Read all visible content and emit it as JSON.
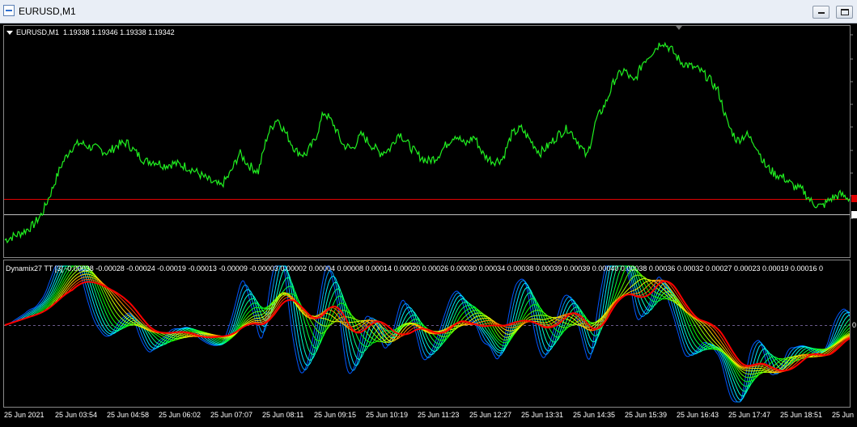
{
  "window": {
    "title": "EURUSD,M1"
  },
  "main_chart": {
    "symbol_label": "EURUSD,M1",
    "ohlc": "1.19338 1.19346 1.19338 1.19342",
    "line_color": "#20f020",
    "current_price_line_color": "#e00000",
    "ask_line_color": "#c0c0c0",
    "background": "#000000"
  },
  "indicator": {
    "name": "Dynamix27 TT [3]",
    "values": "-0.00038 -0.00028 -0.00024 -0.00019 -0.00013 -0.00009 -0.00003 0.00002 0.00004 0.00008 0.00014 0.00020 0.00026 0.00030 0.00034 0.00038 0.00039 0.00039 0.00040 0.00038 0.00036 0.00032 0.00027 0.00023 0.00019 0.00016 0",
    "zero_label": "0",
    "top_right_label": "0"
  },
  "time_axis": {
    "labels": [
      "25 Jun 2021",
      "25 Jun 03:54",
      "25 Jun 04:58",
      "25 Jun 06:02",
      "25 Jun 07:07",
      "25 Jun 08:11",
      "25 Jun 09:15",
      "25 Jun 10:19",
      "25 Jun 11:23",
      "25 Jun 12:27",
      "25 Jun 13:31",
      "25 Jun 14:35",
      "25 Jun 15:39",
      "25 Jun 16:43",
      "25 Jun 17:47",
      "25 Jun 18:51",
      "25 Jun"
    ]
  },
  "chart_data": {
    "type": "line",
    "series": [
      {
        "values": [
          0.04,
          0.06,
          0.08,
          0.11,
          0.17,
          0.28,
          0.4,
          0.48,
          0.51,
          0.49,
          0.48,
          0.46,
          0.5,
          0.51,
          0.46,
          0.42,
          0.42,
          0.4,
          0.41,
          0.4,
          0.38,
          0.35,
          0.32,
          0.3,
          0.36,
          0.46,
          0.4,
          0.37,
          0.55,
          0.63,
          0.55,
          0.47,
          0.45,
          0.52,
          0.66,
          0.6,
          0.5,
          0.48,
          0.55,
          0.5,
          0.46,
          0.48,
          0.56,
          0.5,
          0.45,
          0.42,
          0.44,
          0.5,
          0.55,
          0.5,
          0.54,
          0.45,
          0.42,
          0.43,
          0.55,
          0.58,
          0.52,
          0.46,
          0.5,
          0.55,
          0.58,
          0.52,
          0.44,
          0.62,
          0.7,
          0.82,
          0.86,
          0.8,
          0.9,
          0.95,
          1.0,
          0.96,
          0.9,
          0.88,
          0.86,
          0.82,
          0.76,
          0.6,
          0.52,
          0.55,
          0.5,
          0.4,
          0.36,
          0.34,
          0.3,
          0.28,
          0.22,
          0.2,
          0.24,
          0.26,
          0.24
        ]
      }
    ]
  }
}
